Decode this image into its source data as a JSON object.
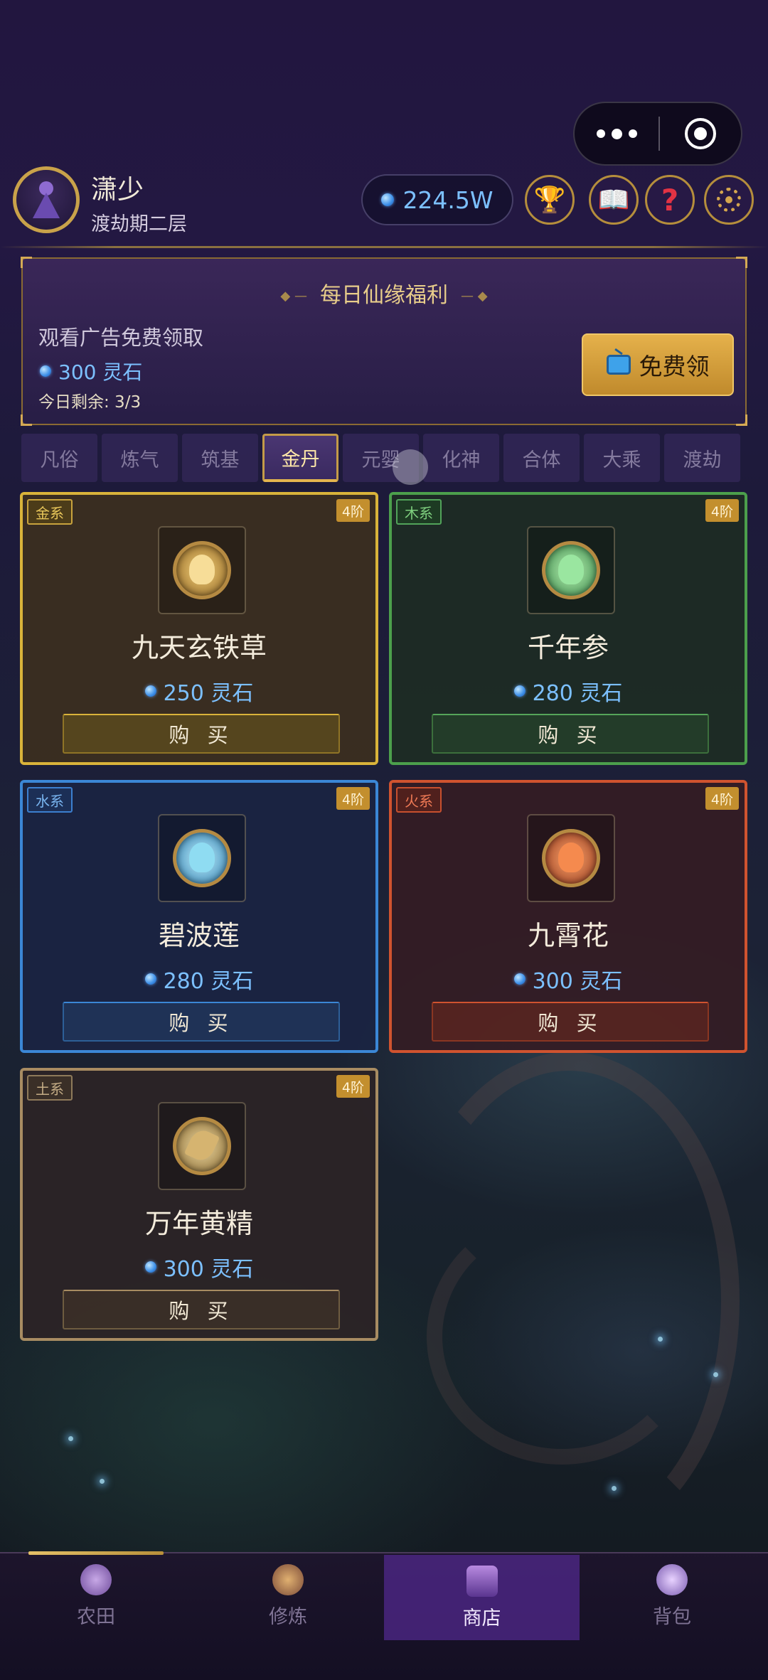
{
  "capsule": {
    "more_icon": "more-dots-icon",
    "record_icon": "record-circle-icon"
  },
  "header": {
    "user_name": "潇少",
    "realm": "渡劫期二层",
    "spirit_stones": "224.5W",
    "buttons": [
      "trophy-icon",
      "book-icon",
      "help-icon",
      "settings-icon"
    ]
  },
  "daily": {
    "title": "每日仙缘福利",
    "description": "观看广告免费领取",
    "reward": "300 灵石",
    "remaining": "今日剩余: 3/3",
    "claim_button": "免费领"
  },
  "tabs": [
    "凡俗",
    "炼气",
    "筑基",
    "金丹",
    "元婴",
    "化神",
    "合体",
    "大乘",
    "渡劫"
  ],
  "active_tab": "金丹",
  "items": [
    {
      "element": "金系",
      "tier": "4阶",
      "name": "九天玄铁草",
      "price": "250 灵石",
      "buy": "购 买",
      "theme": "gold",
      "accent": "#d9b33a"
    },
    {
      "element": "木系",
      "tier": "4阶",
      "name": "千年参",
      "price": "280 灵石",
      "buy": "购 买",
      "theme": "wood",
      "accent": "#4c9f4c"
    },
    {
      "element": "水系",
      "tier": "4阶",
      "name": "碧波莲",
      "price": "280 灵石",
      "buy": "购 买",
      "theme": "water",
      "accent": "#3b87d6"
    },
    {
      "element": "火系",
      "tier": "4阶",
      "name": "九霄花",
      "price": "300 灵石",
      "buy": "购 买",
      "theme": "fire",
      "accent": "#d0532f"
    },
    {
      "element": "土系",
      "tier": "4阶",
      "name": "万年黄精",
      "price": "300 灵石",
      "buy": "购 买",
      "theme": "earth",
      "accent": "#a88c62"
    }
  ],
  "nav": {
    "items": [
      {
        "label": "农田",
        "icon": "farm-icon"
      },
      {
        "label": "修炼",
        "icon": "cultivate-icon"
      },
      {
        "label": "商店",
        "icon": "shop-icon"
      },
      {
        "label": "背包",
        "icon": "backpack-icon"
      }
    ],
    "active": "商店"
  }
}
